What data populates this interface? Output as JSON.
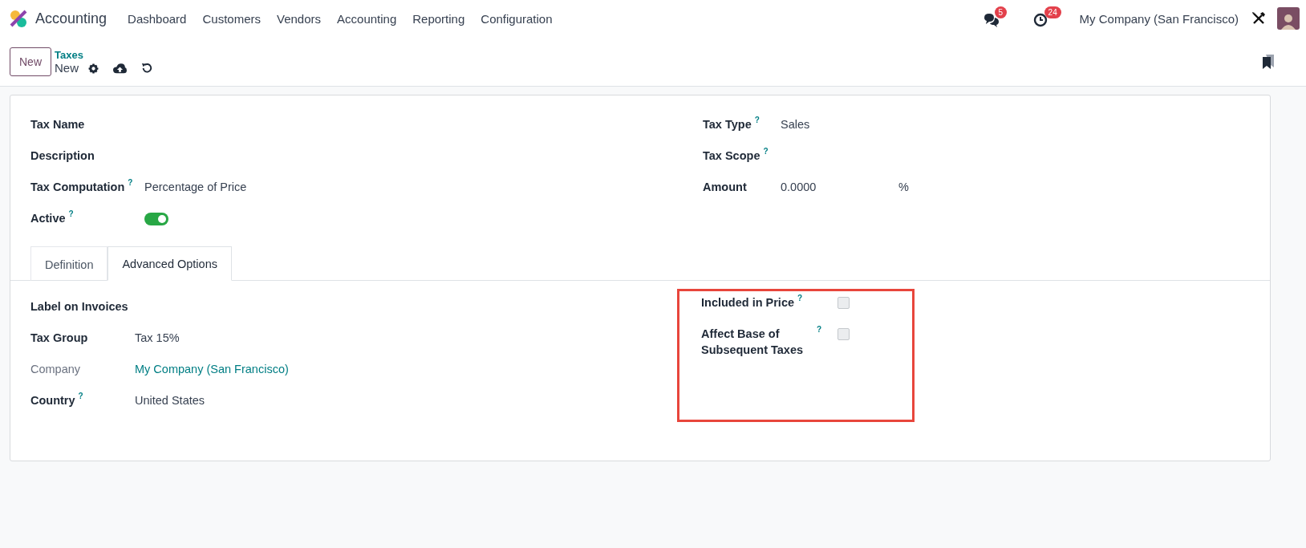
{
  "navbar": {
    "app_name": "Accounting",
    "menu": [
      "Dashboard",
      "Customers",
      "Vendors",
      "Accounting",
      "Reporting",
      "Configuration"
    ],
    "messages_badge": "5",
    "activities_badge": "24",
    "company": "My Company (San Francisco)"
  },
  "control_panel": {
    "new_button": "New",
    "breadcrumb": "Taxes",
    "record": "New"
  },
  "form": {
    "left_fields": [
      {
        "kind": "text",
        "label": "Tax Name",
        "muted": false
      },
      {
        "kind": "text",
        "label": "Description",
        "muted": false
      },
      {
        "kind": "text",
        "label": "Tax Computation",
        "help": "?",
        "muted": false,
        "value": "Percentage of Price"
      },
      {
        "kind": "toggle",
        "label": "Active",
        "help": "?",
        "muted": false,
        "on": true
      }
    ],
    "right_fields": [
      {
        "kind": "text",
        "label": "Tax Type",
        "help": "?",
        "muted": false,
        "value": "Sales"
      },
      {
        "kind": "text",
        "label": "Tax Scope",
        "help": "?",
        "muted": false
      },
      {
        "kind": "amount",
        "label": "Amount",
        "muted": false,
        "value": "0.0000",
        "suffix": "%"
      }
    ],
    "tabs": [
      {
        "label": "Definition",
        "selected": false
      },
      {
        "label": "Advanced Options",
        "selected": true
      }
    ],
    "advanced_left": [
      {
        "kind": "text",
        "label": "Label on Invoices",
        "muted": false
      },
      {
        "kind": "text",
        "label": "Tax Group",
        "muted": false,
        "value": "Tax 15%"
      },
      {
        "kind": "link",
        "label": "Company",
        "muted": true,
        "value": "My Company (San Francisco)"
      },
      {
        "kind": "text",
        "label": "Country",
        "help": "?",
        "muted": false,
        "value": "United States"
      }
    ],
    "advanced_right": {
      "highlighted": true,
      "fields": [
        {
          "kind": "checkbox",
          "label": "Included in Price",
          "help": "?",
          "muted": false,
          "checked": false
        },
        {
          "kind": "checkbox",
          "label": "Affect Base of Subsequent Taxes",
          "help": "?",
          "muted": false,
          "checked": false
        }
      ]
    }
  }
}
